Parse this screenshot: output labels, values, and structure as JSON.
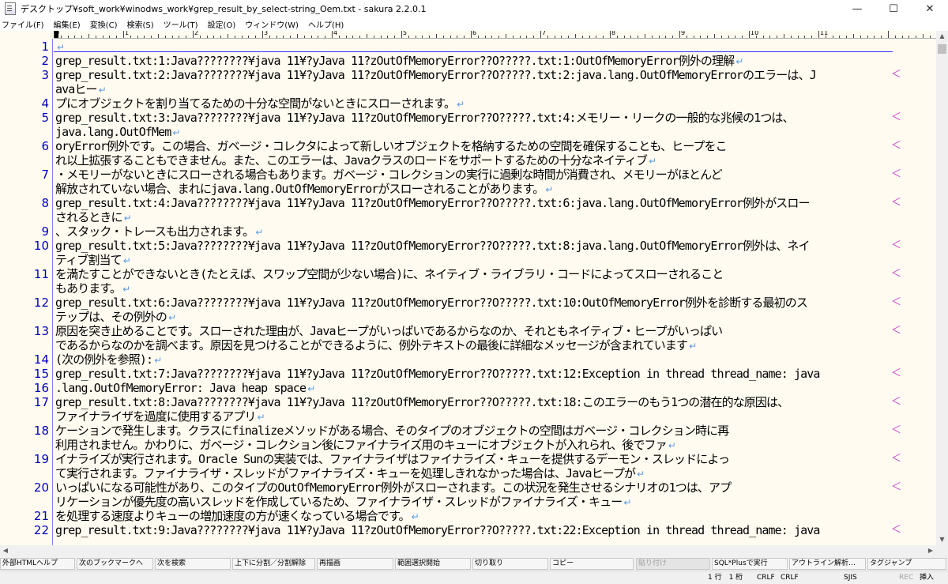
{
  "window": {
    "title": "デスクトップ¥soft_work¥winodws_work¥grep_result_by_select-string_Oem.txt - sakura 2.2.0.1",
    "minimize": "—",
    "maximize": "☐",
    "close": "✕"
  },
  "menu": [
    "ファイル(F)",
    "編集(E)",
    "変換(C)",
    "検索(S)",
    "ツール(T)",
    "設定(O)",
    "ウィンドウ(W)",
    "ヘルプ(H)"
  ],
  "ruler": {
    "numbers": [
      "0",
      "1",
      "2",
      "3",
      "4",
      "5",
      "6",
      "7",
      "8",
      "9",
      "10",
      "11"
    ]
  },
  "editor": {
    "line_numbers": [
      "1",
      "2",
      "3",
      "4",
      "5",
      "6",
      "7",
      "8",
      "9",
      "10",
      "11",
      "12",
      "13",
      "14",
      "15",
      "16",
      "17",
      "18",
      "19",
      "20",
      "21",
      "22"
    ],
    "eol_glyph": "↵",
    "wrap_glyph": "＜",
    "rows": [
      {
        "ln": "1",
        "text": "",
        "eol": true
      },
      {
        "ln": "2",
        "text": "grep_result.txt:1:Java????????¥java 11¥?yJava 11?zOutOfMemoryError??O?????.txt:1:OutOfMemoryError例外の理解",
        "eol": true
      },
      {
        "ln": "3",
        "text": "grep_result.txt:2:Java????????¥java 11¥?yJava 11?zOutOfMemoryError??O?????.txt:2:java.lang.OutOfMemoryErrorのエラーは、J",
        "eol": false,
        "wrap": true
      },
      {
        "ln": "",
        "text": "avaヒー",
        "eol": true
      },
      {
        "ln": "4",
        "text": "プにオブジェクトを割り当てるための十分な空間がないときにスローされます。",
        "eol": true
      },
      {
        "ln": "5",
        "text": "grep_result.txt:3:Java????????¥java 11¥?yJava 11?zOutOfMemoryError??O?????.txt:4:メモリー・リークの一般的な兆候の1つは、",
        "eol": false,
        "wrap": true
      },
      {
        "ln": "",
        "text": "java.lang.OutOfMem",
        "eol": true
      },
      {
        "ln": "6",
        "text": "oryError例外です。この場合、ガベージ・コレクタによって新しいオブジェクトを格納するための空間を確保することも、ヒープをこ",
        "eol": false,
        "wrap": true
      },
      {
        "ln": "",
        "text": "れ以上拡張することもできません。また、このエラーは、Javaクラスのロードをサポートするための十分なネイティブ",
        "eol": true
      },
      {
        "ln": "7",
        "text": "・メモリーがないときにスローされる場合もあります。ガベージ・コレクションの実行に過剰な時間が消費され、メモリーがほとんど",
        "eol": false,
        "wrap": true
      },
      {
        "ln": "",
        "text": "解放されていない場合、まれにjava.lang.OutOfMemoryErrorがスローされることがあります。",
        "eol": true
      },
      {
        "ln": "8",
        "text": "grep_result.txt:4:Java????????¥java 11¥?yJava 11?zOutOfMemoryError??O?????.txt:6:java.lang.OutOfMemoryError例外がスロー",
        "eol": false,
        "wrap": true
      },
      {
        "ln": "",
        "text": "されるときに",
        "eol": true
      },
      {
        "ln": "9",
        "text": "、スタック・トレースも出力されます。",
        "eol": true
      },
      {
        "ln": "10",
        "text": "grep_result.txt:5:Java????????¥java 11¥?yJava 11?zOutOfMemoryError??O?????.txt:8:java.lang.OutOfMemoryError例外は、ネイ",
        "eol": false,
        "wrap": true
      },
      {
        "ln": "",
        "text": "ティブ割当て",
        "eol": true
      },
      {
        "ln": "11",
        "text": "を満たすことができないとき(たとえば、スワップ空間が少ない場合)に、ネイティブ・ライブラリ・コードによってスローされること",
        "eol": false,
        "wrap": true
      },
      {
        "ln": "",
        "text": "もあります。",
        "eol": true
      },
      {
        "ln": "12",
        "text": "grep_result.txt:6:Java????????¥java 11¥?yJava 11?zOutOfMemoryError??O?????.txt:10:OutOfMemoryError例外を診断する最初のス",
        "eol": false,
        "wrap": true
      },
      {
        "ln": "",
        "text": "テップは、その例外の",
        "eol": true
      },
      {
        "ln": "13",
        "text": "原因を突き止めることです。スローされた理由が、Javaヒープがいっぱいであるからなのか、それともネイティブ・ヒープがいっぱい",
        "eol": false,
        "wrap": true
      },
      {
        "ln": "",
        "text": "であるからなのかを調べます。原因を見つけることができるように、例外テキストの最後に詳細なメッセージが含まれています",
        "eol": true
      },
      {
        "ln": "14",
        "text": "(次の例外を参照):",
        "eol": true
      },
      {
        "ln": "15",
        "text": "grep_result.txt:7:Java????????¥java 11¥?yJava 11?zOutOfMemoryError??O?????.txt:12:Exception in thread thread_name: java",
        "eol": false,
        "wrap": true
      },
      {
        "ln": "16",
        "text": ".lang.OutOfMemoryError: Java heap space",
        "eol": true
      },
      {
        "ln": "17",
        "text": "grep_result.txt:8:Java????????¥java 11¥?yJava 11?zOutOfMemoryError??O?????.txt:18:このエラーのもう1つの潜在的な原因は、",
        "eol": false,
        "wrap": true
      },
      {
        "ln": "",
        "text": "ファイナライザを過度に使用するアプリ",
        "eol": true
      },
      {
        "ln": "18",
        "text": "ケーションで発生します。クラスにfinalizeメソッドがある場合、そのタイプのオブジェクトの空間はガベージ・コレクション時に再",
        "eol": false,
        "wrap": true
      },
      {
        "ln": "",
        "text": "利用されません。かわりに、ガベージ・コレクション後にファイナライズ用のキューにオブジェクトが入れられ、後でファ",
        "eol": true
      },
      {
        "ln": "19",
        "text": "イナライズが実行されます。Oracle Sunの実装では、ファイナライザはファイナライズ・キューを提供するデーモン・スレッドによっ",
        "eol": false,
        "wrap": true
      },
      {
        "ln": "",
        "text": "て実行されます。ファイナライザ・スレッドがファイナライズ・キューを処理しきれなかった場合は、Javaヒープが",
        "eol": true
      },
      {
        "ln": "20",
        "text": "いっぱいになる可能性があり、このタイプのOutOfMemoryError例外がスローされます。この状況を発生させるシナリオの1つは、アプ",
        "eol": false,
        "wrap": true
      },
      {
        "ln": "",
        "text": "リケーションが優先度の高いスレッドを作成しているため、ファイナライザ・スレッドがファイナライズ・キュー",
        "eol": true
      },
      {
        "ln": "21",
        "text": "を処理する速度よりキューの増加速度の方が速くなっている場合です。",
        "eol": true
      },
      {
        "ln": "22",
        "text": "grep_result.txt:9:Java????????¥java 11¥?yJava 11?zOutOfMemoryError??O?????.txt:22:Exception in thread thread_name: java",
        "eol": false,
        "wrap": true
      }
    ]
  },
  "fkeys": [
    {
      "label": "外部HTMLヘルプ",
      "disabled": false
    },
    {
      "label": "次のブックマークへ",
      "disabled": false
    },
    {
      "label": "次を検索",
      "disabled": false
    },
    {
      "label": "上下に分割／分割解除",
      "disabled": false
    },
    {
      "label": "再描画",
      "disabled": false
    },
    {
      "label": "範囲選択開始",
      "disabled": false
    },
    {
      "label": "切り取り",
      "disabled": false
    },
    {
      "label": "コピー",
      "disabled": false
    },
    {
      "label": "貼り付け",
      "disabled": true
    },
    {
      "label": "SQL*Plusで実行",
      "disabled": false
    },
    {
      "label": "アウトライン解析…",
      "disabled": false
    },
    {
      "label": "タグジャンプ",
      "disabled": false
    }
  ],
  "status": {
    "position": "1 行　1 桁",
    "line_ending": "CRLF",
    "line_ending2": "CRLF",
    "encoding": "SJIS",
    "rec": "REC",
    "insert": "挿入"
  }
}
